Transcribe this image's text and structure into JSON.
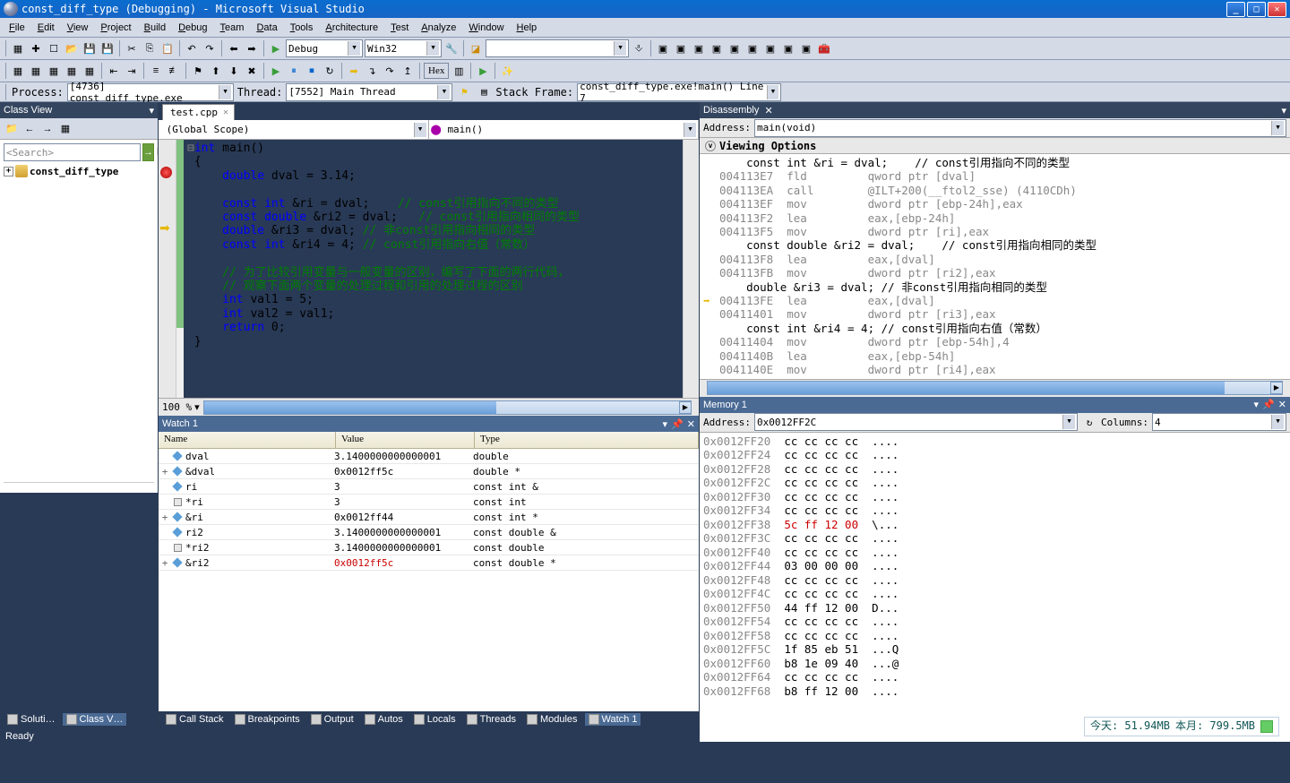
{
  "title": "const_diff_type (Debugging) - Microsoft Visual Studio",
  "menus": [
    "File",
    "Edit",
    "View",
    "Project",
    "Build",
    "Debug",
    "Team",
    "Data",
    "Tools",
    "Architecture",
    "Test",
    "Analyze",
    "Window",
    "Help"
  ],
  "toolbar": {
    "config": "Debug",
    "platform": "Win32",
    "hex": "Hex"
  },
  "debug": {
    "process_label": "Process:",
    "process": "[4736] const_diff_type.exe",
    "thread_label": "Thread:",
    "thread": "[7552] Main Thread",
    "frame_label": "Stack Frame:",
    "frame": "const_diff_type.exe!main() Line 7"
  },
  "classview": {
    "title": "Class View",
    "search_placeholder": "<Search>",
    "project": "const_diff_type"
  },
  "editor": {
    "tab": "test.cpp",
    "scope": "(Global Scope)",
    "func": "main()",
    "zoom": "100 %",
    "code": {
      "l1": "int main()",
      "l2": "{",
      "l3": "    double dval = 3.14;",
      "l4": "",
      "l5": "    const int &ri = dval;    // const引用指向不同的类型",
      "l6": "    const double &ri2 = dval;   // const引用指向相同的类型",
      "l7": "    double &ri3 = dval; // 非const引用指向相同的类型",
      "l8": "    const int &ri4 = 4; // const引用指向右值（常数）",
      "l9": "",
      "l10": "    // 为了比较引用变量与一般变量的区别，编写了下面的两行代码，",
      "l11": "    // 观察下面两个变量的处理过程和引用的处理过程的区别",
      "l12": "    int val1 = 5;",
      "l13": "    int val2 = val1;",
      "l14": "    return 0;",
      "l15": "}"
    }
  },
  "disasm": {
    "title": "Disassembly",
    "address_label": "Address:",
    "address": "main(void)",
    "viewing": "Viewing Options",
    "lines": [
      {
        "g": "",
        "t": "s",
        "txt": "    const int &ri = dval;    // const引用指向不同的类型"
      },
      {
        "g": "",
        "t": "a",
        "addr": "004113E7",
        "op": "fld",
        "args": "qword ptr [dval]"
      },
      {
        "g": "",
        "t": "a",
        "addr": "004113EA",
        "op": "call",
        "args": "@ILT+200(__ftol2_sse) (4110CDh)"
      },
      {
        "g": "",
        "t": "a",
        "addr": "004113EF",
        "op": "mov",
        "args": "dword ptr [ebp-24h],eax"
      },
      {
        "g": "",
        "t": "a",
        "addr": "004113F2",
        "op": "lea",
        "args": "eax,[ebp-24h]"
      },
      {
        "g": "",
        "t": "a",
        "addr": "004113F5",
        "op": "mov",
        "args": "dword ptr [ri],eax"
      },
      {
        "g": "",
        "t": "s",
        "txt": "    const double &ri2 = dval;    // const引用指向相同的类型"
      },
      {
        "g": "",
        "t": "a",
        "addr": "004113F8",
        "op": "lea",
        "args": "eax,[dval]"
      },
      {
        "g": "",
        "t": "a",
        "addr": "004113FB",
        "op": "mov",
        "args": "dword ptr [ri2],eax"
      },
      {
        "g": "",
        "t": "s",
        "txt": "    double &ri3 = dval; // 非const引用指向相同的类型"
      },
      {
        "g": "→",
        "t": "a",
        "addr": "004113FE",
        "op": "lea",
        "args": "eax,[dval]"
      },
      {
        "g": "",
        "t": "a",
        "addr": "00411401",
        "op": "mov",
        "args": "dword ptr [ri3],eax"
      },
      {
        "g": "",
        "t": "s",
        "txt": "    const int &ri4 = 4; // const引用指向右值（常数）"
      },
      {
        "g": "",
        "t": "a",
        "addr": "00411404",
        "op": "mov",
        "args": "dword ptr [ebp-54h],4"
      },
      {
        "g": "",
        "t": "a",
        "addr": "0041140B",
        "op": "lea",
        "args": "eax,[ebp-54h]"
      },
      {
        "g": "",
        "t": "a",
        "addr": "0041140E",
        "op": "mov",
        "args": "dword ptr [ri4],eax"
      }
    ]
  },
  "watch": {
    "title": "Watch 1",
    "h_name": "Name",
    "h_val": "Value",
    "h_type": "Type",
    "rows": [
      {
        "exp": "",
        "ico": "d",
        "n": "dval",
        "v": "3.1400000000000001",
        "t": "double",
        "cls": ""
      },
      {
        "exp": "+",
        "ico": "d",
        "n": "&dval",
        "v": "0x0012ff5c",
        "t": "double *",
        "cls": ""
      },
      {
        "exp": "",
        "ico": "d",
        "n": "ri",
        "v": "3",
        "t": "const int &",
        "cls": ""
      },
      {
        "exp": "",
        "ico": "s",
        "n": "*ri",
        "v": "3",
        "t": "const int",
        "cls": ""
      },
      {
        "exp": "+",
        "ico": "d",
        "n": "&ri",
        "v": "0x0012ff44",
        "t": "const int *",
        "cls": ""
      },
      {
        "exp": "",
        "ico": "d",
        "n": "ri2",
        "v": "3.1400000000000001",
        "t": "const double &",
        "cls": ""
      },
      {
        "exp": "",
        "ico": "s",
        "n": "*ri2",
        "v": "3.1400000000000001",
        "t": "const double",
        "cls": ""
      },
      {
        "exp": "+",
        "ico": "d",
        "n": "&ri2",
        "v": "0x0012ff5c",
        "t": "const double *",
        "cls": "red"
      }
    ]
  },
  "memory": {
    "title": "Memory 1",
    "address_label": "Address:",
    "address": "0x0012FF2C",
    "columns_label": "Columns:",
    "columns": "4",
    "rows": [
      {
        "a": "0x0012FF20",
        "h": "cc cc cc cc",
        "c": "...."
      },
      {
        "a": "0x0012FF24",
        "h": "cc cc cc cc",
        "c": "...."
      },
      {
        "a": "0x0012FF28",
        "h": "cc cc cc cc",
        "c": "...."
      },
      {
        "a": "0x0012FF2C",
        "h": "cc cc cc cc",
        "c": "...."
      },
      {
        "a": "0x0012FF30",
        "h": "cc cc cc cc",
        "c": "...."
      },
      {
        "a": "0x0012FF34",
        "h": "cc cc cc cc",
        "c": "...."
      },
      {
        "a": "0x0012FF38",
        "h": "5c ff 12 00",
        "c": "\\...",
        "red": true
      },
      {
        "a": "0x0012FF3C",
        "h": "cc cc cc cc",
        "c": "...."
      },
      {
        "a": "0x0012FF40",
        "h": "cc cc cc cc",
        "c": "...."
      },
      {
        "a": "0x0012FF44",
        "h": "03 00 00 00",
        "c": "...."
      },
      {
        "a": "0x0012FF48",
        "h": "cc cc cc cc",
        "c": "...."
      },
      {
        "a": "0x0012FF4C",
        "h": "cc cc cc cc",
        "c": "...."
      },
      {
        "a": "0x0012FF50",
        "h": "44 ff 12 00",
        "c": "D..."
      },
      {
        "a": "0x0012FF54",
        "h": "cc cc cc cc",
        "c": "...."
      },
      {
        "a": "0x0012FF58",
        "h": "cc cc cc cc",
        "c": "...."
      },
      {
        "a": "0x0012FF5C",
        "h": "1f 85 eb 51",
        "c": "...Q"
      },
      {
        "a": "0x0012FF60",
        "h": "b8 1e 09 40",
        "c": "...@"
      },
      {
        "a": "0x0012FF64",
        "h": "cc cc cc cc",
        "c": "...."
      },
      {
        "a": "0x0012FF68",
        "h": "b8 ff 12 00",
        "c": "...."
      }
    ]
  },
  "bottom_tabs_left": [
    "Soluti…",
    "Class V…"
  ],
  "bottom_tabs_mid": [
    "Call Stack",
    "Breakpoints",
    "Output",
    "Autos",
    "Locals",
    "Threads",
    "Modules",
    "Watch 1"
  ],
  "status": "Ready",
  "mem_badge": {
    "today": "今天: 51.94MB",
    "month": "本月: 799.5MB"
  }
}
